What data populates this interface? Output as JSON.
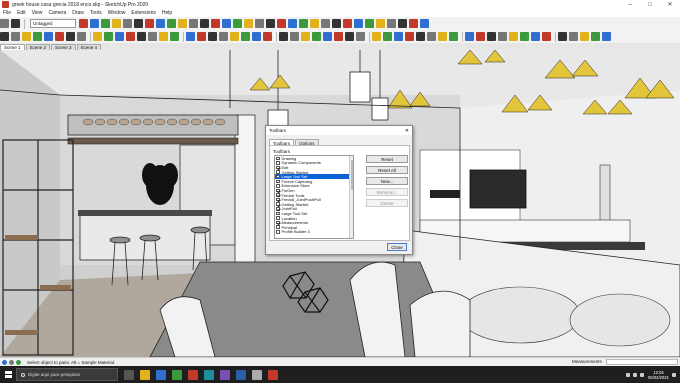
{
  "window": {
    "title": "greek house casa grecia 2018 enco.skp - SketchUp Pro 2020",
    "buttons": [
      "minimize",
      "maximize",
      "close"
    ]
  },
  "menu": [
    "File",
    "Edit",
    "View",
    "Camera",
    "Draw",
    "Tools",
    "Window",
    "Extensions",
    "Help"
  ],
  "toolbar": {
    "layer_value": "Untagged",
    "colors": {
      "red": "#c0392b",
      "blue": "#2e6fd1",
      "green": "#3c9a3c",
      "yellow": "#e2b21b",
      "gray": "#777777",
      "dark": "#333333"
    }
  },
  "scene_tabs": [
    {
      "label": "Scene 1",
      "active": true
    },
    {
      "label": "Scene 2",
      "active": false
    },
    {
      "label": "Scene 3",
      "active": false
    },
    {
      "label": "Scene 4",
      "active": false
    }
  ],
  "dialog": {
    "title": "Toolbars",
    "tabs": [
      {
        "label": "Toolbars",
        "active": true
      },
      {
        "label": "Options",
        "active": false
      }
    ],
    "group_label": "Toolbars",
    "items": [
      {
        "label": "Drawing",
        "checked": false,
        "selected": false
      },
      {
        "label": "Dynamic Components",
        "checked": false,
        "selected": false
      },
      {
        "label": "Edit",
        "checked": true,
        "selected": false
      },
      {
        "label": "Getting Started",
        "checked": false,
        "selected": false
      },
      {
        "label": "Large Tool Set",
        "checked": false,
        "selected": true
      },
      {
        "label": "Freeze Capturing",
        "checked": false,
        "selected": false
      },
      {
        "label": "Extension Store",
        "checked": false,
        "selected": false
      },
      {
        "label": "FinGen",
        "checked": true,
        "selected": false
      },
      {
        "label": "Fredo6 Tools",
        "checked": true,
        "selected": false
      },
      {
        "label": "Fredo6_JointPushPull",
        "checked": true,
        "selected": false
      },
      {
        "label": "Getting Started",
        "checked": true,
        "selected": false
      },
      {
        "label": "JointPull",
        "checked": true,
        "selected": false
      },
      {
        "label": "Large Tool Set",
        "checked": false,
        "selected": false
      },
      {
        "label": "Location",
        "checked": false,
        "selected": false
      },
      {
        "label": "Measurements",
        "checked": true,
        "selected": false
      },
      {
        "label": "Principal",
        "checked": false,
        "selected": false
      },
      {
        "label": "Profile Builder 3",
        "checked": false,
        "selected": false
      }
    ],
    "buttons": [
      {
        "label": "Reset",
        "enabled": true
      },
      {
        "label": "Reset All",
        "enabled": true
      },
      {
        "label": "New...",
        "enabled": true
      },
      {
        "label": "Rename...",
        "enabled": false
      },
      {
        "label": "Delete",
        "enabled": false
      }
    ],
    "close_label": "Close"
  },
  "status": {
    "text": "Select object to paint. Alt = Sample Material.",
    "measurements_label": "Measurements"
  },
  "taskbar": {
    "search_placeholder": "Digite aqui para pesquisar",
    "time": "12:04",
    "date": "05/02/2021"
  }
}
